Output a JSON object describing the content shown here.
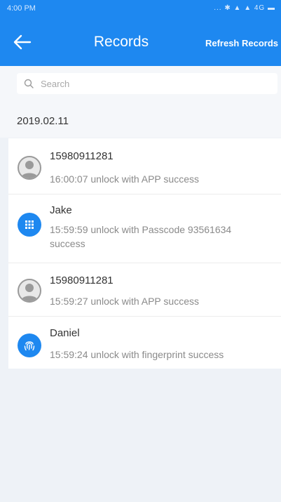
{
  "status_bar": {
    "time": "4:00 PM",
    "indicators": "... ✱ ▲ ▲ 4G ▬"
  },
  "header": {
    "back_icon": "arrow-left-icon",
    "title": "Records",
    "refresh_label": "Refresh Records"
  },
  "search": {
    "placeholder": "Search",
    "value": "",
    "icon": "search-icon"
  },
  "date_group": "2019.02.11",
  "records": [
    {
      "name": "15980911281",
      "detail": "16:00:07 unlock with APP success",
      "icon": "person-icon"
    },
    {
      "name": "Jake",
      "detail": "15:59:59 unlock with Passcode 93561634 success",
      "icon": "keypad-icon"
    },
    {
      "name": "15980911281",
      "detail": "15:59:27 unlock with APP success",
      "icon": "person-icon"
    },
    {
      "name": "Daniel",
      "detail": "15:59:24 unlock with fingerprint success",
      "icon": "fingerprint-icon"
    }
  ],
  "colors": {
    "primary": "#1e88f0",
    "background": "#eef2f7",
    "text_primary": "#333333",
    "text_secondary": "#8a8a8a"
  }
}
